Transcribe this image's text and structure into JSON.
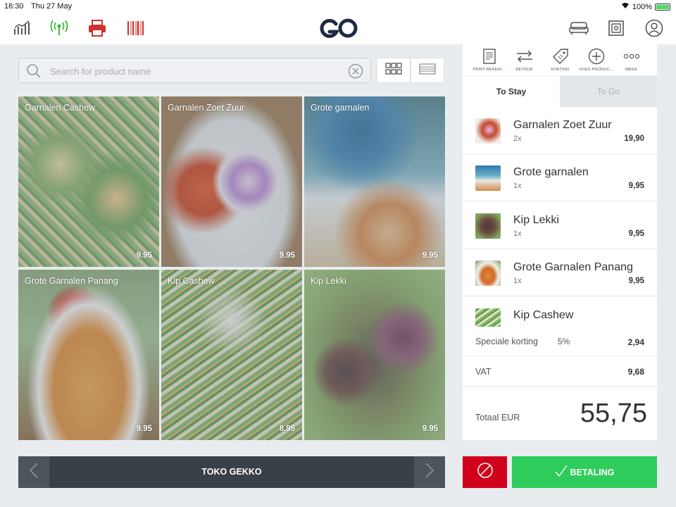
{
  "statusbar": {
    "time": "16:30",
    "date": "Thu 27 May",
    "battery": "100%"
  },
  "header": {
    "logo_text": "GO"
  },
  "search": {
    "placeholder": "Search for product name"
  },
  "products": [
    {
      "name": "Garnalen Cashew",
      "price": "9.95"
    },
    {
      "name": "Garnalen Zoet Zuur",
      "price": "9.95"
    },
    {
      "name": "Grote garnalen",
      "price": "9.95"
    },
    {
      "name": "Grote Garnalen Panang",
      "price": "9.95"
    },
    {
      "name": "Kip Cashew",
      "price": "8.95"
    },
    {
      "name": "Kip Lekki",
      "price": "9.95"
    }
  ],
  "bottom": {
    "table_label": "TOKO GEKKO"
  },
  "actions": [
    {
      "label": "PRINT REKENI...",
      "icon": "receipt-icon"
    },
    {
      "label": "RETOUR",
      "icon": "return-arrows-icon"
    },
    {
      "label": "KORTING",
      "icon": "discount-tag-icon"
    },
    {
      "label": "VOEG PRODUC...",
      "icon": "add-circle-icon"
    },
    {
      "label": "MEER",
      "icon": "more-dots-icon"
    }
  ],
  "tabs": {
    "stay": "To Stay",
    "go": "To Go"
  },
  "order_items": [
    {
      "name": "Garnalen Zoet Zuur",
      "qty": "2x",
      "price": "19,90"
    },
    {
      "name": "Grote garnalen",
      "qty": "1x",
      "price": "9,95"
    },
    {
      "name": "Kip Lekki",
      "qty": "1x",
      "price": "9,95"
    },
    {
      "name": "Grote Garnalen Panang",
      "qty": "1x",
      "price": "9,95"
    },
    {
      "name": "Kip Cashew",
      "qty": "",
      "price": ""
    }
  ],
  "summary": {
    "discount_label": "Speciale korting",
    "discount_pct": "5%",
    "discount_value": "2,94",
    "vat_label": "VAT",
    "vat_value": "9,68",
    "total_label": "Totaal EUR",
    "total_value": "55,75"
  },
  "payment": {
    "pay_label": "BETALING"
  },
  "colors": {
    "cancel": "#d0021b",
    "pay": "#2ecc5a",
    "dark_bar": "#3a4048",
    "logo": "#1f2a44"
  }
}
